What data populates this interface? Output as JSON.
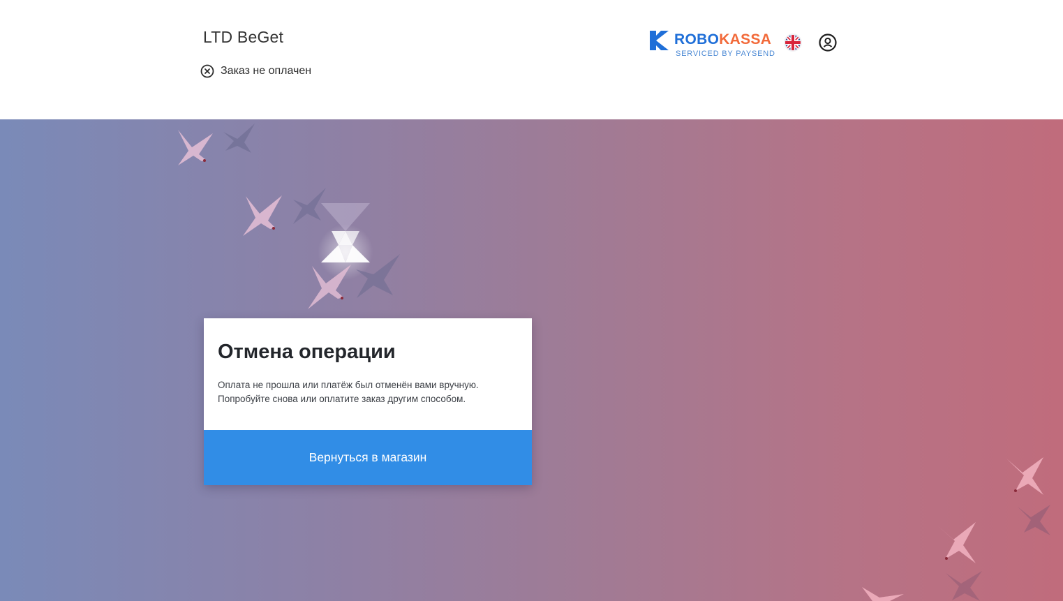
{
  "header": {
    "merchant_name": "LTD BeGet",
    "order_status": "Заказ не оплачен",
    "status_icon": "close-circle-icon",
    "logo": {
      "brand_part1": "ROBO",
      "brand_part2": "KASSA",
      "subtitle": "SERVICED BY PAYSEND"
    },
    "language_icon": "uk-flag-icon",
    "user_icon": "user-icon"
  },
  "card": {
    "title": "Отмена операции",
    "line1": "Оплата не прошла или платёж был отменён вами вручную.",
    "line2": "Попробуйте снова или оплатите заказ другим способом.",
    "button_label": "Вернуться в магазин"
  },
  "colors": {
    "accent": "#318de6",
    "brand_blue": "#1f6fd8",
    "brand_orange": "#f26a3a",
    "gradient_left": "#7a8ab8",
    "gradient_right": "#c06c7c"
  }
}
